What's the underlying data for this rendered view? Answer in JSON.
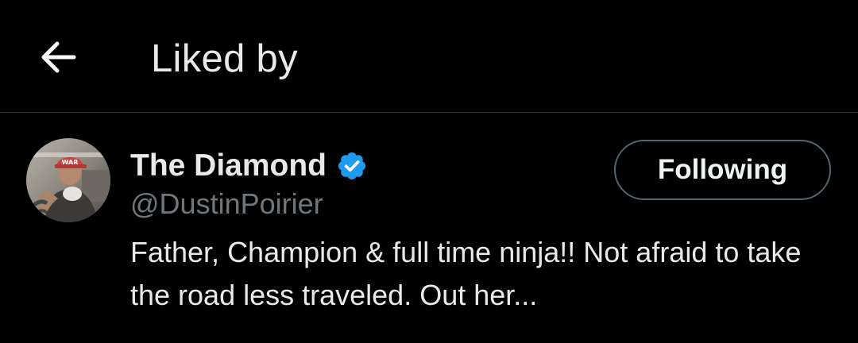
{
  "header": {
    "title": "Liked by",
    "back_icon": "arrow-left-icon"
  },
  "user": {
    "display_name": "The Diamond",
    "handle": "@DustinPoirier",
    "verified": true,
    "verified_color": "#1d9bf0",
    "bio": "Father, Champion & full time ninja!! Not afraid to take the road less traveled. Out her...",
    "follow_button_label": "Following",
    "avatar_cap_text": "WAR"
  },
  "colors": {
    "background": "#000000",
    "text_primary": "#e7e9ea",
    "text_secondary": "#71767b",
    "divider": "#2f3336",
    "button_border": "#536471"
  }
}
